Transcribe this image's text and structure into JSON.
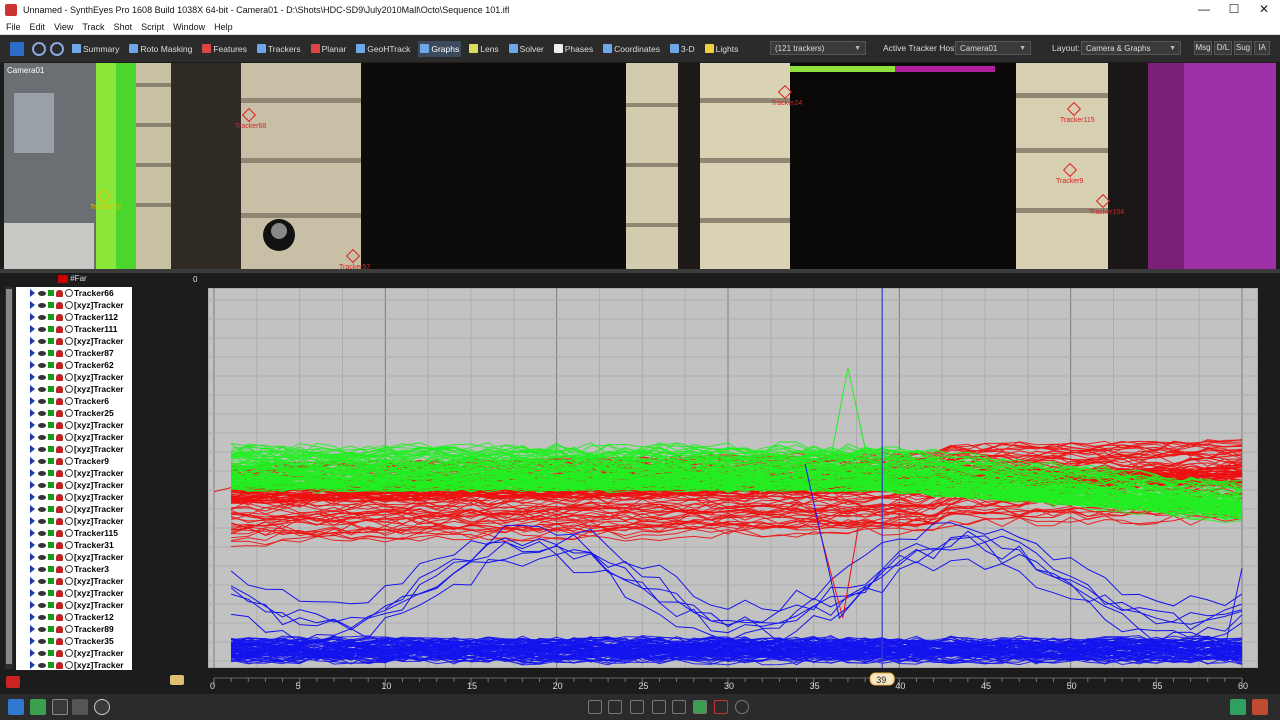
{
  "window": {
    "title": "Unnamed - SynthEyes Pro 1608 Build 1038X 64-bit - Camera01 - D:\\Shots\\HDC-SD9\\July2010Mall\\Octo\\Sequence 101.ifl",
    "minimize": "—",
    "maximize": "☐",
    "close": "✕"
  },
  "menu": [
    "File",
    "Edit",
    "View",
    "Track",
    "Shot",
    "Script",
    "Window",
    "Help"
  ],
  "toolbar": {
    "rooms": [
      {
        "label": "Summary",
        "icon": "summary-icon",
        "color": "#6fa8e8"
      },
      {
        "label": "Roto Masking",
        "icon": "roto-masking-icon",
        "color": "#6fa8e8"
      },
      {
        "label": "Features",
        "icon": "features-icon",
        "color": "#d44"
      },
      {
        "label": "Trackers",
        "icon": "trackers-icon",
        "color": "#6fa8e8"
      },
      {
        "label": "Planar",
        "icon": "planar-icon",
        "color": "#d44"
      },
      {
        "label": "GeoHTrack",
        "icon": "geohtrack-icon",
        "color": "#6fa8e8"
      },
      {
        "label": "Graphs",
        "icon": "graphs-icon",
        "color": "#6fa8e8"
      },
      {
        "label": "Lens",
        "icon": "lens-icon",
        "color": "#dcdc60"
      },
      {
        "label": "Solver",
        "icon": "solver-icon",
        "color": "#6fa8e8"
      },
      {
        "label": "Phases",
        "icon": "phases-icon",
        "color": "#eee"
      },
      {
        "label": "Coordinates",
        "icon": "coordinates-icon",
        "color": "#6fa8e8"
      },
      {
        "label": "3-D",
        "icon": "3d-icon",
        "color": "#6fa8e8"
      },
      {
        "label": "Lights",
        "icon": "lights-icon",
        "color": "#f0d040"
      }
    ],
    "active_room": "Graphs",
    "tracker_filter": "(121 trackers)",
    "active_tracker_host_label": "Active Tracker Host:",
    "active_tracker_host": "Camera01",
    "layout_label": "Layout:",
    "layout": "Camera & Graphs",
    "msg": "Msg",
    "dl": "D/L",
    "sug": "Sug",
    "ia": "IA"
  },
  "viewport": {
    "camera_label": "Camera01",
    "trackers": [
      {
        "name": "Tracker72",
        "color": "#e8c000"
      },
      {
        "name": "Tracker68",
        "color": "#d22"
      },
      {
        "name": "Tracker24",
        "color": "#d22"
      },
      {
        "name": "Tracker115",
        "color": "#d22"
      },
      {
        "name": "Tracker9",
        "color": "#d22"
      },
      {
        "name": "Tracker104",
        "color": "#d22"
      },
      {
        "name": "Tracker57",
        "color": "#d22"
      }
    ]
  },
  "tracker_list": {
    "header": "#Far",
    "items": [
      "Tracker66",
      "[xyz]Tracker",
      "Tracker112",
      "Tracker111",
      "[xyz]Tracker",
      "Tracker87",
      "Tracker62",
      "[xyz]Tracker",
      "[xyz]Tracker",
      "Tracker6",
      "Tracker25",
      "[xyz]Tracker",
      "[xyz]Tracker",
      "[xyz]Tracker",
      "Tracker9",
      "[xyz]Tracker",
      "[xyz]Tracker",
      "[xyz]Tracker",
      "[xyz]Tracker",
      "[xyz]Tracker",
      "Tracker115",
      "Tracker31",
      "[xyz]Tracker",
      "Tracker3",
      "[xyz]Tracker",
      "[xyz]Tracker",
      "[xyz]Tracker",
      "Tracker12",
      "Tracker89",
      "Tracker35",
      "[xyz]Tracker",
      "[xyz]Tracker"
    ]
  },
  "graph": {
    "top_value": "0",
    "current_frame": "39",
    "frame_ticks": [
      "0",
      "5",
      "10",
      "15",
      "20",
      "25",
      "30",
      "35",
      "40",
      "45",
      "50",
      "55",
      "60"
    ],
    "colors": {
      "green": "#22ee22",
      "red": "#ee1111",
      "blue": "#1414ee",
      "cursor": "#3a3ad0",
      "background": "#c2c2c2"
    }
  }
}
